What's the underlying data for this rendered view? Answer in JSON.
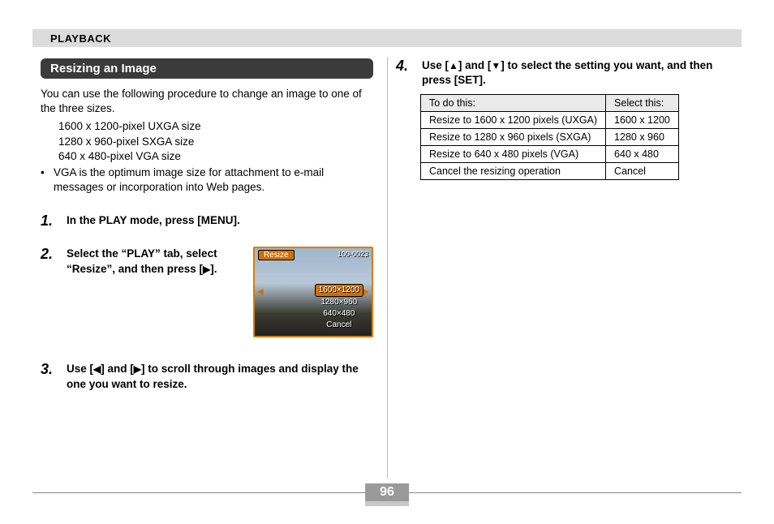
{
  "header": {
    "section": "PLAYBACK"
  },
  "left": {
    "title": "Resizing an Image",
    "intro": "You can use the following procedure to change an image to one of the three sizes.",
    "sizes": [
      {
        "dim": "1600 x 1200",
        "label": "-pixel UXGA size"
      },
      {
        "dim": "1280 x   960",
        "label": "-pixel SXGA size"
      },
      {
        "dim": "  640 x   480",
        "label": "-pixel VGA size"
      }
    ],
    "note": "VGA is the optimum image size for attachment to e-mail messages or incorporation into Web pages.",
    "steps": {
      "s1": {
        "num": "1.",
        "body": "In the PLAY mode, press [MENU]."
      },
      "s2": {
        "num": "2.",
        "body_pre": "Select the “PLAY” tab, select “Resize”, and then press [",
        "body_post": "]."
      },
      "s3": {
        "num": "3.",
        "body_pre": "Use [",
        "body_mid": "] and [",
        "body_post": "] to scroll through images and display the one you want to resize."
      }
    },
    "lcd": {
      "title": "Resize",
      "id": "100-0023",
      "options": [
        "1600×1200",
        "1280×960",
        "640×480",
        "Cancel"
      ]
    }
  },
  "right": {
    "step4": {
      "num": "4.",
      "body_pre": "Use [",
      "body_mid": "] and [",
      "body_post": "] to select the setting you want, and then press [SET]."
    },
    "table": {
      "header": [
        "To do this:",
        "Select this:"
      ],
      "rows": [
        [
          "Resize to 1600 x 1200 pixels (UXGA)",
          "1600 x 1200"
        ],
        [
          "Resize to 1280 x 960 pixels (SXGA)",
          "1280 x 960"
        ],
        [
          "Resize to 640 x 480 pixels (VGA)",
          "640 x 480"
        ],
        [
          "Cancel the resizing operation",
          "Cancel"
        ]
      ]
    }
  },
  "page_number": "96",
  "glyphs": {
    "up": "▲",
    "down": "▼",
    "left": "◀",
    "right": "▶"
  }
}
